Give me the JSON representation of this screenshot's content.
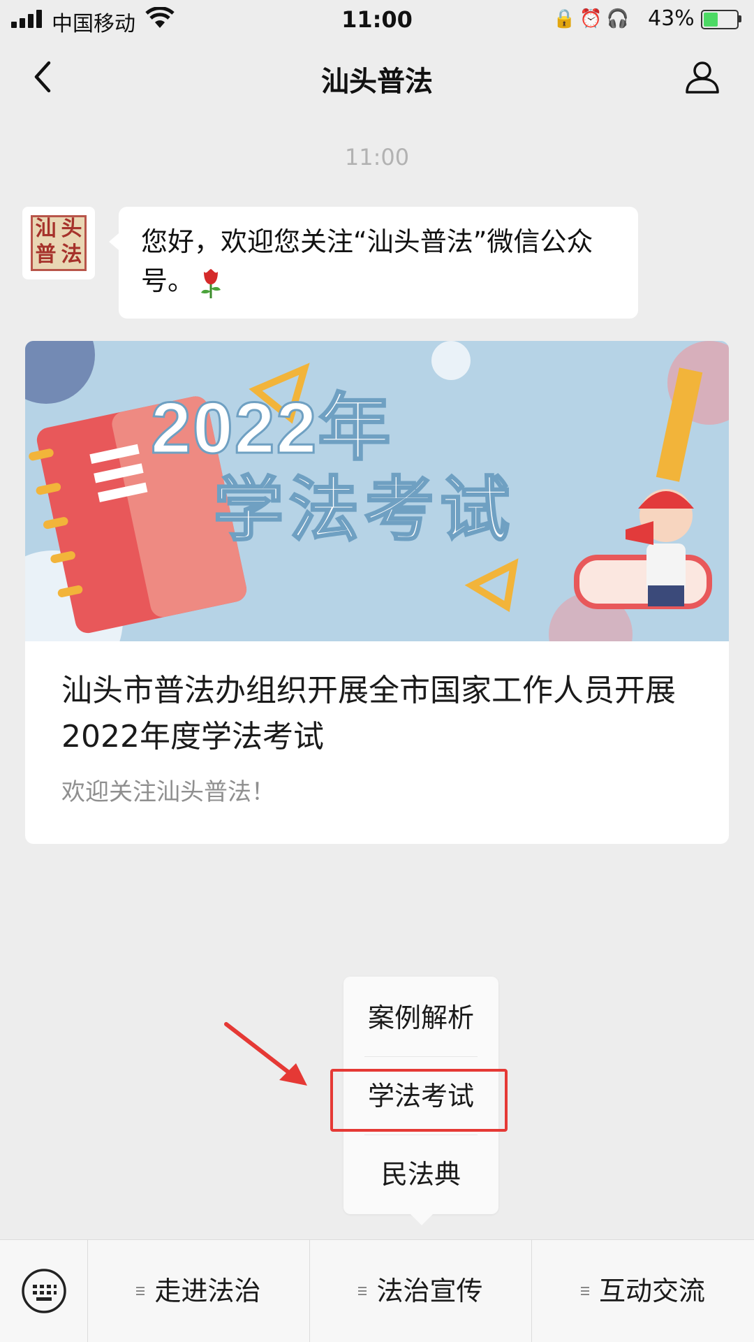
{
  "status_bar": {
    "carrier": "中国移动",
    "time": "11:00",
    "battery": "43%",
    "battery_level": 0.43
  },
  "nav": {
    "title": "汕头普法"
  },
  "chat": {
    "timestamp": "11:00",
    "avatar_seal": [
      "汕",
      "头",
      "普",
      "法"
    ],
    "message": "您好，欢迎您关注“汕头普法”微信公众号。",
    "article": {
      "banner_year": "2022年",
      "banner_headline": "学法考试",
      "title": "汕头市普法办组织开展全市国家工作人员开展2022年度学法考试",
      "subtitle": "欢迎关注汕头普法！"
    }
  },
  "popup_menu": {
    "items": [
      "案例解析",
      "学法考试",
      "民法典"
    ],
    "highlighted": "学法考试"
  },
  "bottom_menu": {
    "tabs": [
      "走进法治",
      "法治宣传",
      "互动交流"
    ]
  },
  "colors": {
    "highlight": "#e53935",
    "background": "#ededed"
  }
}
